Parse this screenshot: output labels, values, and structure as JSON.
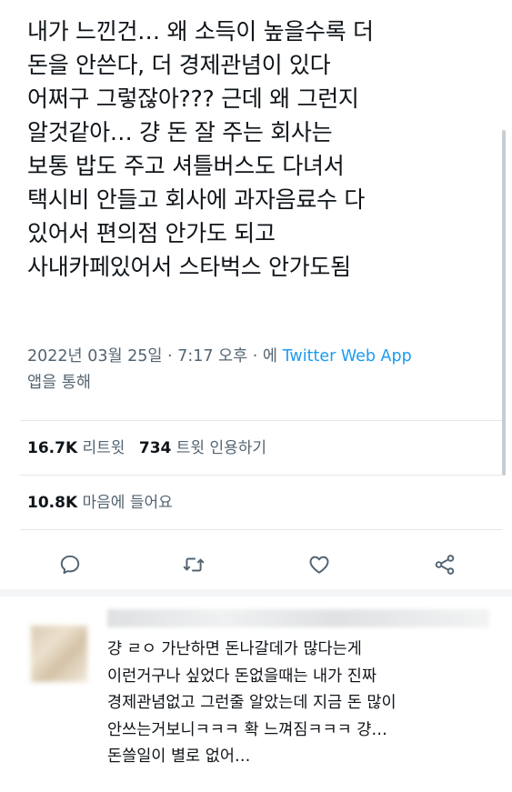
{
  "tweet": {
    "lines": [
      "내가 느낀건… 왜 소득이 높을수록 더",
      "돈을 안쓴다, 더 경제관념이 있다",
      "어쩌구 그렇잖아??? 근데 왜 그런지",
      "알것같아… 걍 돈 잘 주는 회사는",
      "보통 밥도 주고 셔틀버스도 다녀서",
      "택시비 안들고 회사에 과자음료수 다",
      "있어서 편의점 안가도 되고",
      "사내카페있어서 스타벅스 안가도됨"
    ],
    "timestamp": "2022년 03월 25일 · 7:17 오후 · 에",
    "client": "Twitter Web App",
    "via": "앱을 통해"
  },
  "stats": {
    "retweets": "16.7K",
    "retweets_label": "리트윗",
    "quotes": "734",
    "quotes_label": "트윗 인용하기",
    "likes": "10.8K",
    "likes_label": "마음에 들어요"
  },
  "actions": {
    "reply": "reply-icon",
    "retweet": "retweet-icon",
    "like": "heart-icon",
    "share": "share-icon"
  },
  "reply": {
    "lines": [
      "걍 ㄹㅇ 가난하면 돈나갈데가 많다는게",
      "이런거구나 싶었다 돈없을때는 내가 진짜",
      "경제관념없고 그런줄 알았는데 지금 돈 많이",
      "안쓰는거보니ㅋㅋㅋ 확 느껴짐ㅋㅋㅋ 걍…",
      "돈쓸일이 별로 없어…"
    ]
  },
  "colors": {
    "text": "#0f1419",
    "secondary": "#536471",
    "link": "#1d9bf0"
  }
}
